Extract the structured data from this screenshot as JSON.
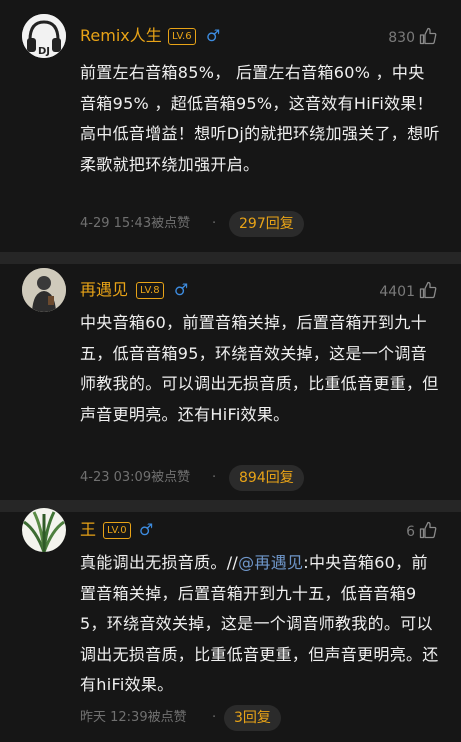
{
  "colors": {
    "background": "#161616",
    "divider": "#262626",
    "username": "#e8a317",
    "gender_male": "#3d8ce0",
    "body_text": "#f0f0f0",
    "meta_text": "#707070",
    "mention": "#6f96c9"
  },
  "comments": [
    {
      "username": "Remix人生",
      "level": "LV.6",
      "gender_icon": "♂",
      "likes": "830",
      "text": "前置左右音箱85%， 后置左右音箱60% ，中央音箱95% ，超低音箱95%，这音效有HiFi效果！高中低音增益！想听Dj的就把环绕加强关了，想听柔歌就把环绕加强开启。",
      "timestamp": "4-29 15:43被点赞",
      "separator": "·",
      "replies": "297回复"
    },
    {
      "username": "再遇见",
      "level": "LV.8",
      "gender_icon": "♂",
      "likes": "4401",
      "text": "中央音箱60，前置音箱关掉，后置音箱开到九十五，低音音箱95，环绕音效关掉，这是一个调音师教我的。可以调出无损音质，比重低音更重，但声音更明亮。还有HiFi效果。",
      "timestamp": "4-23 03:09被点赞",
      "separator": "·",
      "replies": "894回复"
    },
    {
      "username": "王",
      "level": "LV.0",
      "gender_icon": "♂",
      "likes": "6",
      "text_prefix": "真能调出无损音质。//",
      "mention": "@再遇见",
      "text_suffix": ":中央音箱60，前置音箱关掉，后置音箱开到九十五，低音音箱95，环绕音效关掉，这是一个调音师教我的。可以调出无损音质，比重低音更重，但声音更明亮。还有hiFi效果。",
      "timestamp": "昨天 12:39被点赞",
      "separator": "·",
      "replies": "3回复"
    }
  ]
}
